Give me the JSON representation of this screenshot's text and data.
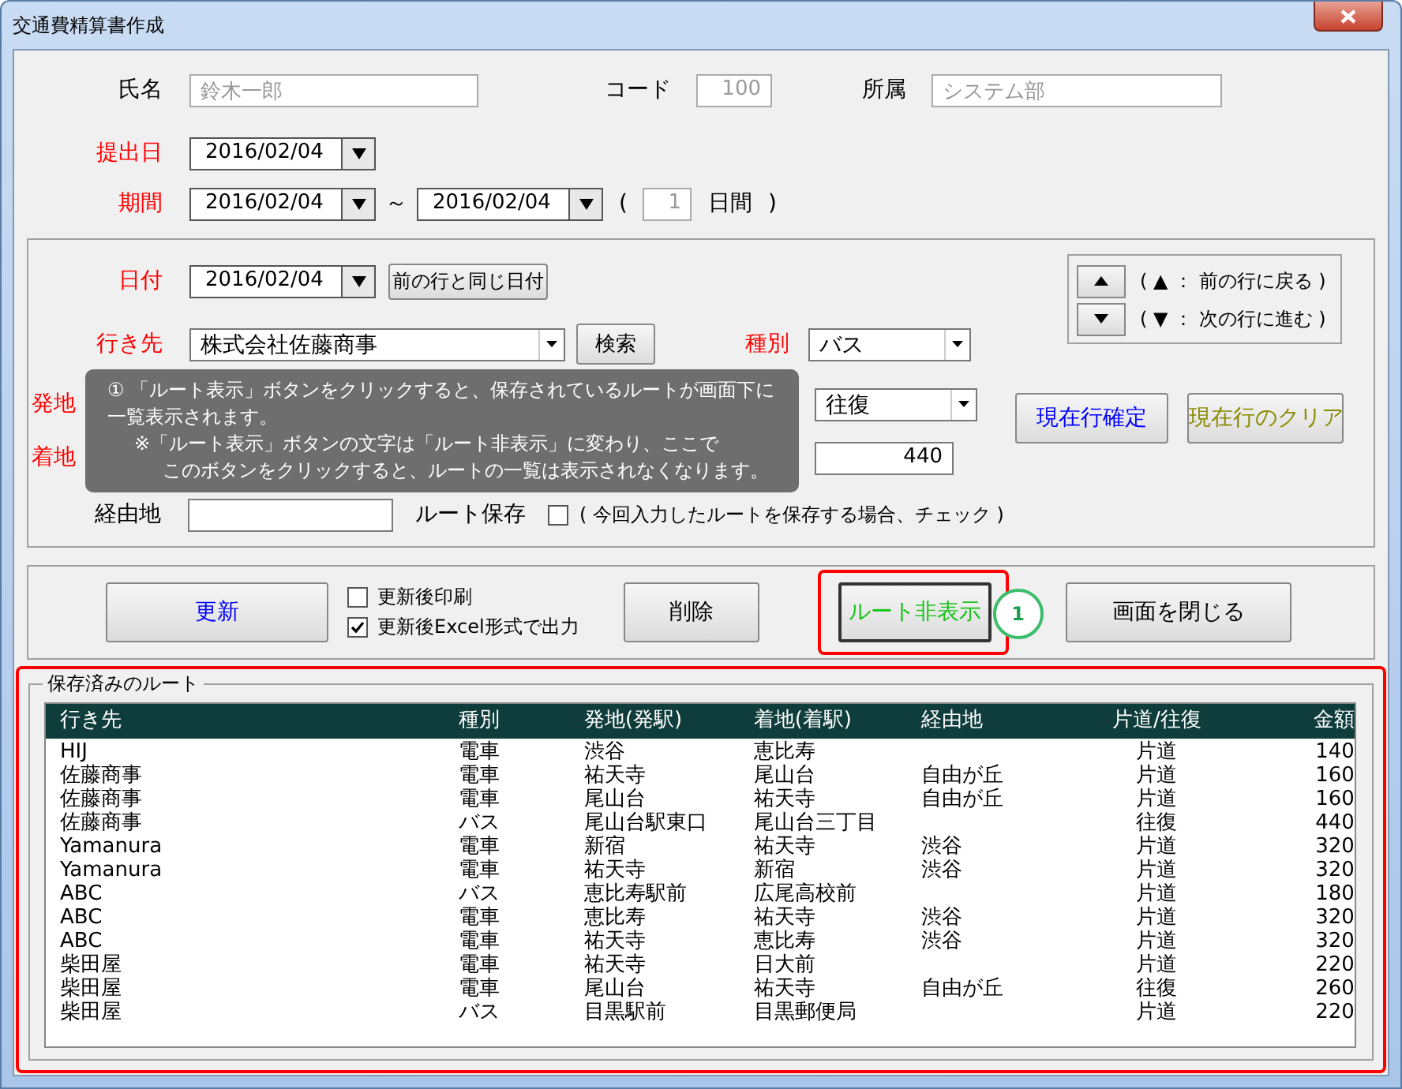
{
  "window": {
    "title": "交通費精算書作成"
  },
  "header": {
    "name": {
      "label": "氏名",
      "value": "鈴木一郎",
      "readonly": true
    },
    "code": {
      "label": "コード",
      "value": "100",
      "readonly": true
    },
    "dept": {
      "label": "所属",
      "value": "システム部",
      "readonly": true
    },
    "submit_date": {
      "label": "提出日",
      "required": true,
      "value": "2016/02/04"
    },
    "period": {
      "label": "期間",
      "required": true,
      "from": "2016/02/04",
      "separator": "～",
      "to": "2016/02/04",
      "open": "(",
      "days": "1",
      "unit": "日間",
      "close": ")"
    }
  },
  "detail": {
    "date": {
      "label": "日付",
      "required": true,
      "value": "2016/02/04",
      "button": "前の行と同じ日付"
    },
    "destination": {
      "label": "行き先",
      "required": true,
      "value": "株式会社佐藤商事",
      "button": "検索"
    },
    "type": {
      "label": "種別",
      "required": true,
      "value": "バス"
    },
    "origin": {
      "label": "発地",
      "required": true
    },
    "arrival": {
      "label": "着地",
      "required": true
    },
    "trip": {
      "value": "往復"
    },
    "amount": {
      "value": "440"
    },
    "via": {
      "label": "経由地",
      "required": false
    },
    "save_route": {
      "label": "ルート保存",
      "checked": false,
      "hint": "( 今回入力したルートを保存する場合、チェック )"
    },
    "nav": {
      "up_hint": "( ▲ ： 前の行に戻る )",
      "down_hint": "( ▼ ： 次の行に進む )"
    },
    "confirm_button": "現在行確定",
    "clear_button": "現在行のクリア"
  },
  "tooltip": {
    "lines": [
      "① 「ルート表示」ボタンをクリックすると、保存されているルートが画面下に",
      "一覧表示されます。",
      "※「ルート表示」ボタンの文字は「ルート非表示」に変わり、ここで",
      "このボタンをクリックすると、ルートの一覧は表示されなくなります。"
    ]
  },
  "actions": {
    "update_button": "更新",
    "options": [
      {
        "label": "更新後印刷",
        "checked": false
      },
      {
        "label": "更新後Excel形式で出力",
        "checked": true
      }
    ],
    "delete_button": "削除",
    "route_button": "ルート非表示",
    "callout": "1",
    "close_button": "画面を閉じる"
  },
  "saved_routes": {
    "title": "保存済みのルート",
    "columns": [
      "行き先",
      "種別",
      "発地(発駅)",
      "着地(着駅)",
      "経由地",
      "片道/往復",
      "金額"
    ],
    "rows": [
      [
        "HIJ",
        "電車",
        "渋谷",
        "恵比寿",
        "",
        "片道",
        "140"
      ],
      [
        "佐藤商事",
        "電車",
        "祐天寺",
        "尾山台",
        "自由が丘",
        "片道",
        "160"
      ],
      [
        "佐藤商事",
        "電車",
        "尾山台",
        "祐天寺",
        "自由が丘",
        "片道",
        "160"
      ],
      [
        "佐藤商事",
        "バス",
        "尾山台駅東口",
        "尾山台三丁目",
        "",
        "往復",
        "440"
      ],
      [
        "Yamanura",
        "電車",
        "新宿",
        "祐天寺",
        "渋谷",
        "片道",
        "320"
      ],
      [
        "Yamanura",
        "電車",
        "祐天寺",
        "新宿",
        "渋谷",
        "片道",
        "320"
      ],
      [
        "ABC",
        "バス",
        "恵比寿駅前",
        "広尾高校前",
        "",
        "片道",
        "180"
      ],
      [
        "ABC",
        "電車",
        "恵比寿",
        "祐天寺",
        "渋谷",
        "片道",
        "320"
      ],
      [
        "ABC",
        "電車",
        "祐天寺",
        "恵比寿",
        "渋谷",
        "片道",
        "320"
      ],
      [
        "柴田屋",
        "電車",
        "祐天寺",
        "日大前",
        "",
        "片道",
        "220"
      ],
      [
        "柴田屋",
        "電車",
        "尾山台",
        "祐天寺",
        "自由が丘",
        "往復",
        "260"
      ],
      [
        "柴田屋",
        "バス",
        "目黒駅前",
        "目黒郵便局",
        "",
        "片道",
        "220"
      ]
    ]
  }
}
